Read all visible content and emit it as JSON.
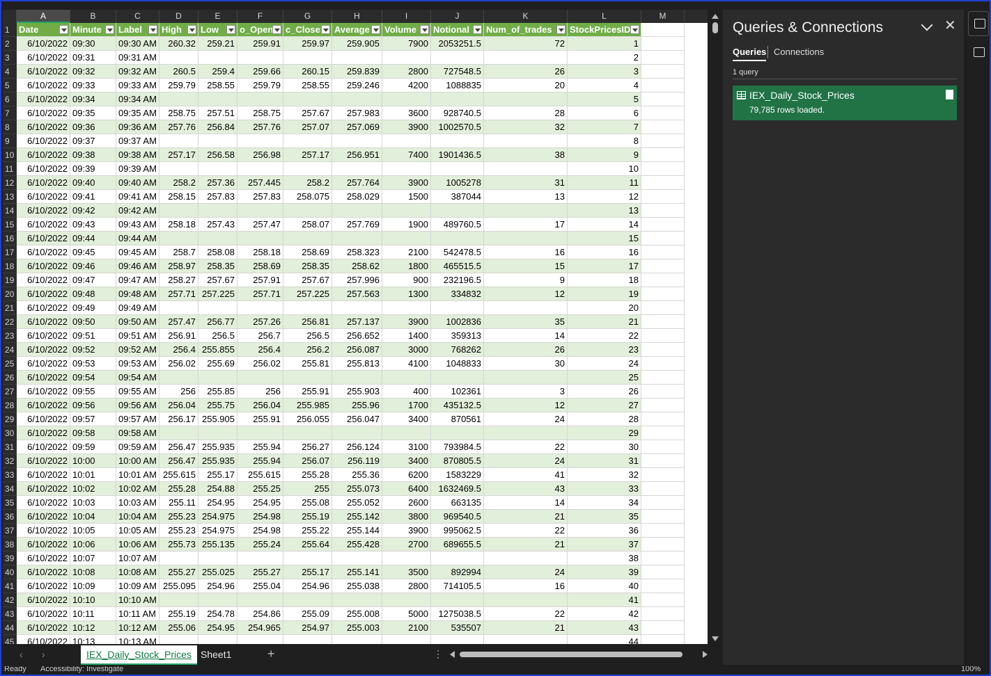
{
  "columns": [
    "A",
    "B",
    "C",
    "D",
    "E",
    "F",
    "G",
    "H",
    "I",
    "J",
    "K",
    "L",
    "M"
  ],
  "selected_column": "A",
  "headers": [
    "Date",
    "Minute",
    "Label",
    "High",
    "Low",
    "o_Open",
    "c_Close",
    "Average",
    "Volume",
    "Notional",
    "Num_of_trades",
    "StockPricesID"
  ],
  "rows": [
    [
      "2",
      "6/10/2022",
      "09:30",
      "09:30 AM",
      "260.32",
      "259.21",
      "259.91",
      "259.97",
      "259.905",
      "7900",
      "2053251.5",
      "72",
      "1"
    ],
    [
      "3",
      "6/10/2022",
      "09:31",
      "09:31 AM",
      "",
      "",
      "",
      "",
      "",
      "",
      "",
      "",
      "2"
    ],
    [
      "4",
      "6/10/2022",
      "09:32",
      "09:32 AM",
      "260.5",
      "259.4",
      "259.66",
      "260.15",
      "259.839",
      "2800",
      "727548.5",
      "26",
      "3"
    ],
    [
      "5",
      "6/10/2022",
      "09:33",
      "09:33 AM",
      "259.79",
      "258.55",
      "259.79",
      "258.55",
      "259.246",
      "4200",
      "1088835",
      "20",
      "4"
    ],
    [
      "6",
      "6/10/2022",
      "09:34",
      "09:34 AM",
      "",
      "",
      "",
      "",
      "",
      "",
      "",
      "",
      "5"
    ],
    [
      "7",
      "6/10/2022",
      "09:35",
      "09:35 AM",
      "258.75",
      "257.51",
      "258.75",
      "257.67",
      "257.983",
      "3600",
      "928740.5",
      "28",
      "6"
    ],
    [
      "8",
      "6/10/2022",
      "09:36",
      "09:36 AM",
      "257.76",
      "256.84",
      "257.76",
      "257.07",
      "257.069",
      "3900",
      "1002570.5",
      "32",
      "7"
    ],
    [
      "9",
      "6/10/2022",
      "09:37",
      "09:37 AM",
      "",
      "",
      "",
      "",
      "",
      "",
      "",
      "",
      "8"
    ],
    [
      "10",
      "6/10/2022",
      "09:38",
      "09:38 AM",
      "257.17",
      "256.58",
      "256.98",
      "257.17",
      "256.951",
      "7400",
      "1901436.5",
      "38",
      "9"
    ],
    [
      "11",
      "6/10/2022",
      "09:39",
      "09:39 AM",
      "",
      "",
      "",
      "",
      "",
      "",
      "",
      "",
      "10"
    ],
    [
      "12",
      "6/10/2022",
      "09:40",
      "09:40 AM",
      "258.2",
      "257.36",
      "257.445",
      "258.2",
      "257.764",
      "3900",
      "1005278",
      "31",
      "11"
    ],
    [
      "13",
      "6/10/2022",
      "09:41",
      "09:41 AM",
      "258.15",
      "257.83",
      "257.83",
      "258.075",
      "258.029",
      "1500",
      "387044",
      "13",
      "12"
    ],
    [
      "14",
      "6/10/2022",
      "09:42",
      "09:42 AM",
      "",
      "",
      "",
      "",
      "",
      "",
      "",
      "",
      "13"
    ],
    [
      "15",
      "6/10/2022",
      "09:43",
      "09:43 AM",
      "258.18",
      "257.43",
      "257.47",
      "258.07",
      "257.769",
      "1900",
      "489760.5",
      "17",
      "14"
    ],
    [
      "16",
      "6/10/2022",
      "09:44",
      "09:44 AM",
      "",
      "",
      "",
      "",
      "",
      "",
      "",
      "",
      "15"
    ],
    [
      "17",
      "6/10/2022",
      "09:45",
      "09:45 AM",
      "258.7",
      "258.08",
      "258.18",
      "258.69",
      "258.323",
      "2100",
      "542478.5",
      "16",
      "16"
    ],
    [
      "18",
      "6/10/2022",
      "09:46",
      "09:46 AM",
      "258.97",
      "258.35",
      "258.69",
      "258.35",
      "258.62",
      "1800",
      "465515.5",
      "15",
      "17"
    ],
    [
      "19",
      "6/10/2022",
      "09:47",
      "09:47 AM",
      "258.27",
      "257.67",
      "257.91",
      "257.67",
      "257.996",
      "900",
      "232196.5",
      "9",
      "18"
    ],
    [
      "20",
      "6/10/2022",
      "09:48",
      "09:48 AM",
      "257.71",
      "257.225",
      "257.71",
      "257.225",
      "257.563",
      "1300",
      "334832",
      "12",
      "19"
    ],
    [
      "21",
      "6/10/2022",
      "09:49",
      "09:49 AM",
      "",
      "",
      "",
      "",
      "",
      "",
      "",
      "",
      "20"
    ],
    [
      "22",
      "6/10/2022",
      "09:50",
      "09:50 AM",
      "257.47",
      "256.77",
      "257.26",
      "256.81",
      "257.137",
      "3900",
      "1002836",
      "35",
      "21"
    ],
    [
      "23",
      "6/10/2022",
      "09:51",
      "09:51 AM",
      "256.91",
      "256.5",
      "256.7",
      "256.5",
      "256.652",
      "1400",
      "359313",
      "14",
      "22"
    ],
    [
      "24",
      "6/10/2022",
      "09:52",
      "09:52 AM",
      "256.4",
      "255.855",
      "256.4",
      "256.2",
      "256.087",
      "3000",
      "768262",
      "26",
      "23"
    ],
    [
      "25",
      "6/10/2022",
      "09:53",
      "09:53 AM",
      "256.02",
      "255.69",
      "256.02",
      "255.81",
      "255.813",
      "4100",
      "1048833",
      "30",
      "24"
    ],
    [
      "26",
      "6/10/2022",
      "09:54",
      "09:54 AM",
      "",
      "",
      "",
      "",
      "",
      "",
      "",
      "",
      "25"
    ],
    [
      "27",
      "6/10/2022",
      "09:55",
      "09:55 AM",
      "256",
      "255.85",
      "256",
      "255.91",
      "255.903",
      "400",
      "102361",
      "3",
      "26"
    ],
    [
      "28",
      "6/10/2022",
      "09:56",
      "09:56 AM",
      "256.04",
      "255.75",
      "256.04",
      "255.985",
      "255.96",
      "1700",
      "435132.5",
      "12",
      "27"
    ],
    [
      "29",
      "6/10/2022",
      "09:57",
      "09:57 AM",
      "256.17",
      "255.905",
      "255.91",
      "256.055",
      "256.047",
      "3400",
      "870561",
      "24",
      "28"
    ],
    [
      "30",
      "6/10/2022",
      "09:58",
      "09:58 AM",
      "",
      "",
      "",
      "",
      "",
      "",
      "",
      "",
      "29"
    ],
    [
      "31",
      "6/10/2022",
      "09:59",
      "09:59 AM",
      "256.47",
      "255.935",
      "255.94",
      "256.27",
      "256.124",
      "3100",
      "793984.5",
      "22",
      "30"
    ],
    [
      "32",
      "6/10/2022",
      "10:00",
      "10:00 AM",
      "256.47",
      "255.935",
      "255.94",
      "256.07",
      "256.119",
      "3400",
      "870805.5",
      "24",
      "31"
    ],
    [
      "33",
      "6/10/2022",
      "10:01",
      "10:01 AM",
      "255.615",
      "255.17",
      "255.615",
      "255.28",
      "255.36",
      "6200",
      "1583229",
      "41",
      "32"
    ],
    [
      "34",
      "6/10/2022",
      "10:02",
      "10:02 AM",
      "255.28",
      "254.88",
      "255.25",
      "255",
      "255.073",
      "6400",
      "1632469.5",
      "43",
      "33"
    ],
    [
      "35",
      "6/10/2022",
      "10:03",
      "10:03 AM",
      "255.11",
      "254.95",
      "254.95",
      "255.08",
      "255.052",
      "2600",
      "663135",
      "14",
      "34"
    ],
    [
      "36",
      "6/10/2022",
      "10:04",
      "10:04 AM",
      "255.23",
      "254.975",
      "254.98",
      "255.19",
      "255.142",
      "3800",
      "969540.5",
      "21",
      "35"
    ],
    [
      "37",
      "6/10/2022",
      "10:05",
      "10:05 AM",
      "255.23",
      "254.975",
      "254.98",
      "255.22",
      "255.144",
      "3900",
      "995062.5",
      "22",
      "36"
    ],
    [
      "38",
      "6/10/2022",
      "10:06",
      "10:06 AM",
      "255.73",
      "255.135",
      "255.24",
      "255.64",
      "255.428",
      "2700",
      "689655.5",
      "21",
      "37"
    ],
    [
      "39",
      "6/10/2022",
      "10:07",
      "10:07 AM",
      "",
      "",
      "",
      "",
      "",
      "",
      "",
      "",
      "38"
    ],
    [
      "40",
      "6/10/2022",
      "10:08",
      "10:08 AM",
      "255.27",
      "255.025",
      "255.27",
      "255.17",
      "255.141",
      "3500",
      "892994",
      "24",
      "39"
    ],
    [
      "41",
      "6/10/2022",
      "10:09",
      "10:09 AM",
      "255.095",
      "254.96",
      "255.04",
      "254.96",
      "255.038",
      "2800",
      "714105.5",
      "16",
      "40"
    ],
    [
      "42",
      "6/10/2022",
      "10:10",
      "10:10 AM",
      "",
      "",
      "",
      "",
      "",
      "",
      "",
      "",
      "41"
    ],
    [
      "43",
      "6/10/2022",
      "10:11",
      "10:11 AM",
      "255.19",
      "254.78",
      "254.86",
      "255.09",
      "255.008",
      "5000",
      "1275038.5",
      "22",
      "42"
    ],
    [
      "44",
      "6/10/2022",
      "10:12",
      "10:12 AM",
      "255.06",
      "254.95",
      "254.965",
      "254.97",
      "255.003",
      "2100",
      "535507",
      "21",
      "43"
    ],
    [
      "45",
      "6/10/2022",
      "10:13",
      "10:13 AM",
      "",
      "",
      "",
      "",
      "",
      "",
      "",
      "",
      "44"
    ]
  ],
  "sheet_tabs": [
    "IEX_Daily_Stock_Prices",
    "Sheet1"
  ],
  "active_tab": "IEX_Daily_Stock_Prices",
  "pane": {
    "title": "Queries & Connections",
    "tab_queries": "Queries",
    "tab_connections": "Connections",
    "count": "1 query",
    "query_name": "IEX_Daily_Stock_Prices",
    "query_status": "79,785 rows loaded."
  },
  "status": {
    "ready": "Ready",
    "accessibility": "Accessibility: Investigate",
    "zoom": "100%"
  },
  "colors": {
    "header_green": "#70ad47",
    "band_green": "#e2efda",
    "query_card": "#217346"
  }
}
